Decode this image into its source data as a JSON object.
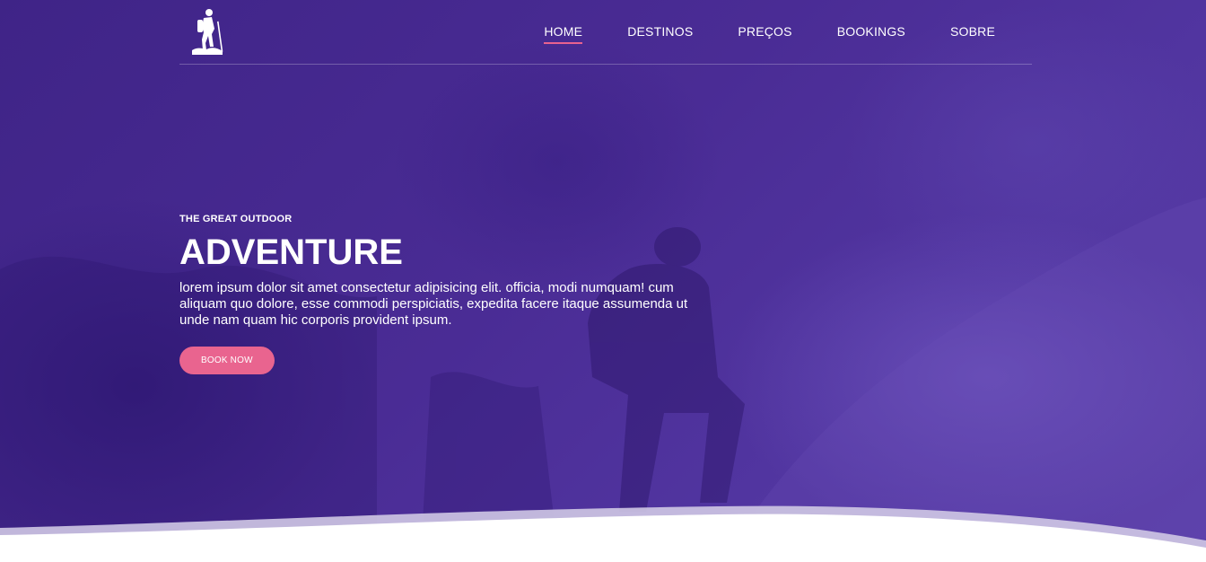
{
  "nav": {
    "logo": "hiker-logo-icon",
    "items": [
      {
        "label": "HOME",
        "active": true
      },
      {
        "label": "DESTINOS",
        "active": false
      },
      {
        "label": "PREÇOS",
        "active": false
      },
      {
        "label": "BOOKINGS",
        "active": false
      },
      {
        "label": "SOBRE",
        "active": false
      }
    ]
  },
  "hero": {
    "eyebrow": "THE GREAT OUTDOOR",
    "title": "ADVENTURE",
    "description": "lorem ipsum dolor sit amet consectetur adipisicing elit. officia, modi numquam! cum aliquam quo dolore, esse commodi perspiciatis, expedita facere itaque assumenda ut unde nam quam hic corporis provident ipsum.",
    "cta_label": "BOOK NOW"
  },
  "colors": {
    "overlay": "#4a2c95",
    "accent": "#e9648f",
    "text": "#ffffff"
  }
}
